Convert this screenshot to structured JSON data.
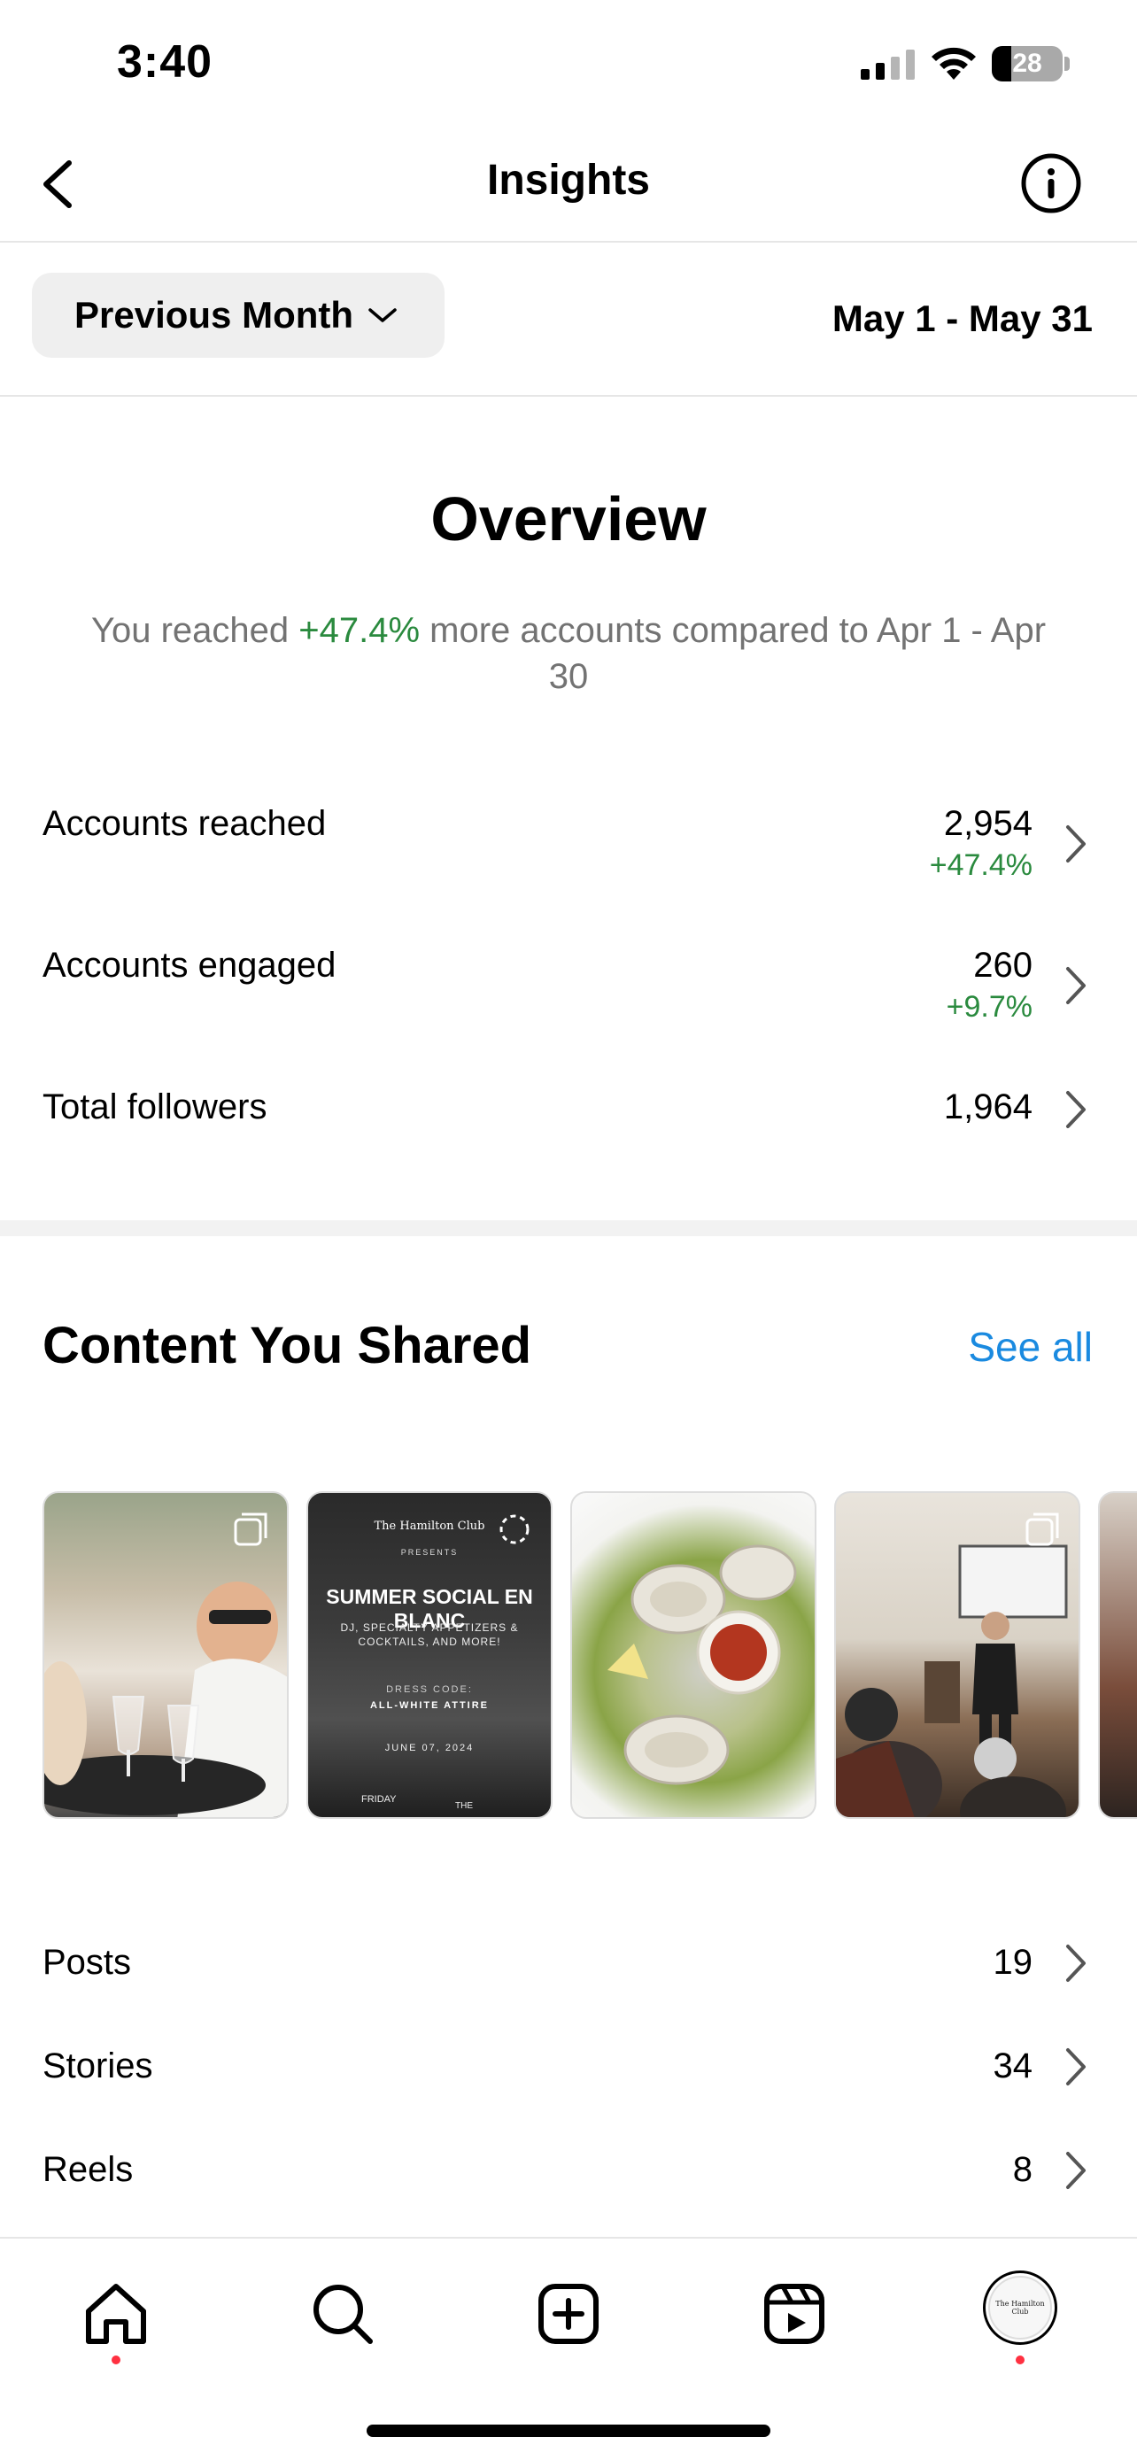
{
  "status_bar": {
    "time": "3:40",
    "battery_percent": "28",
    "icons": [
      "cellular-signal-icon",
      "wifi-icon",
      "battery-icon"
    ]
  },
  "header": {
    "title": "Insights",
    "back_icon": "chevron-left-icon",
    "info_icon": "info-circle-icon"
  },
  "filter": {
    "period_label": "Previous Month",
    "period_icon": "chevron-down-icon",
    "date_range": "May 1 - May 31"
  },
  "overview": {
    "title": "Overview",
    "summary_prefix": "You reached ",
    "summary_change": "+47.4%",
    "summary_suffix": " more accounts compared to Apr 1 - Apr 30",
    "metrics": [
      {
        "label": "Accounts reached",
        "value": "2,954",
        "change": "+47.4%"
      },
      {
        "label": "Accounts engaged",
        "value": "260",
        "change": "+9.7%"
      },
      {
        "label": "Total followers",
        "value": "1,964",
        "change": ""
      }
    ]
  },
  "content": {
    "title": "Content You Shared",
    "see_all": "See all",
    "flyer": {
      "brand": "The Hamilton Club",
      "presents": "PRESENTS",
      "headline": "SUMMER SOCIAL EN BLANC",
      "subline": "DJ, SPECIALTY APPETIZERS & COCKTAILS, AND MORE!",
      "dress_code": "DRESS CODE:",
      "attire": "ALL-WHITE ATTIRE",
      "date": "JUNE 07, 2024",
      "day": "FRIDAY",
      "the": "THE"
    },
    "counts": [
      {
        "label": "Posts",
        "value": "19"
      },
      {
        "label": "Stories",
        "value": "34"
      },
      {
        "label": "Reels",
        "value": "8"
      }
    ]
  },
  "tab_bar": {
    "tabs": [
      "home-icon",
      "search-icon",
      "create-post-icon",
      "reels-icon",
      "profile-avatar"
    ],
    "avatar_text": "The Hamilton Club"
  },
  "colors": {
    "positive": "#2a8a3e",
    "link": "#1a8ae0",
    "notification_dot": "#ff3040"
  }
}
